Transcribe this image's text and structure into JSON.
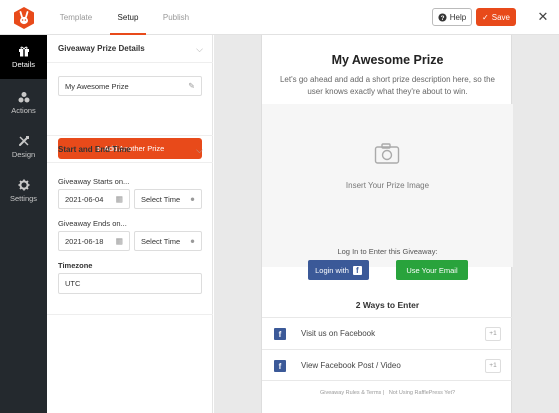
{
  "header": {
    "tabs": [
      {
        "label": "Template",
        "active": false
      },
      {
        "label": "Setup",
        "active": true
      },
      {
        "label": "Publish",
        "active": false
      }
    ],
    "help_label": "Help",
    "save_label": "Save",
    "accent": "#e84a1a"
  },
  "sidebar": {
    "items": [
      {
        "label": "Details",
        "icon": "gift-icon",
        "active": true
      },
      {
        "label": "Actions",
        "icon": "actions-icon",
        "active": false
      },
      {
        "label": "Design",
        "icon": "design-icon",
        "active": false
      },
      {
        "label": "Settings",
        "icon": "gear-icon",
        "active": false
      }
    ]
  },
  "panel": {
    "prize_section_title": "Giveaway Prize Details",
    "prize_name": "My Awesome Prize",
    "add_prize_label": "Add Another Prize",
    "time_section_title": "Start and End Time",
    "starts_label": "Giveaway Starts on...",
    "starts_date": "2021-06-04",
    "starts_time_placeholder": "Select Time",
    "ends_label": "Giveaway Ends on...",
    "ends_date": "2021-06-18",
    "ends_time_placeholder": "Select Time",
    "timezone_label": "Timezone",
    "timezone_value": "UTC"
  },
  "preview": {
    "title": "My Awesome Prize",
    "description": "Let's go ahead and add a short prize description here, so the user knows exactly what they're about to win.",
    "image_placeholder": "Insert Your Prize Image",
    "login_text": "Log In to Enter this Giveaway:",
    "login_facebook_label": "Login with",
    "email_label": "Use Your Email",
    "ways_title": "2 Ways to Enter",
    "entries": [
      {
        "label": "Visit us on Facebook",
        "points": "+1"
      },
      {
        "label": "View Facebook Post / Video",
        "points": "+1"
      }
    ],
    "footer": "Giveaway Rules & Terms |   Not Using RafflePress Yet?",
    "facebook_color": "#3b5998",
    "email_color": "#29a33c"
  }
}
